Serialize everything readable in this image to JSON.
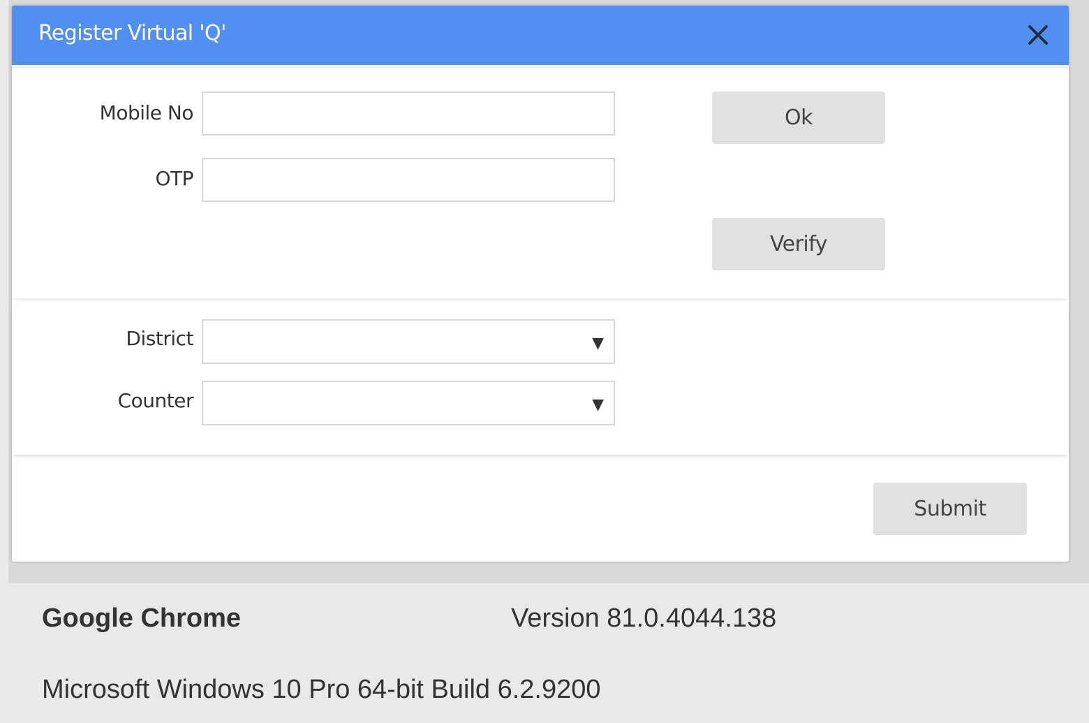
{
  "modal": {
    "title": "Register Virtual 'Q'",
    "header_color": "#5190f0"
  },
  "form": {
    "mobile_label": "Mobile No",
    "mobile_value": "",
    "otp_label": "OTP",
    "otp_value": "",
    "ok_label": "Ok",
    "verify_label": "Verify",
    "district_label": "District",
    "district_value": "",
    "counter_label": "Counter",
    "counter_value": "",
    "submit_label": "Submit"
  },
  "info": {
    "browser_name": "Google Chrome",
    "browser_version": "Version 81.0.4044.138",
    "os": "Microsoft Windows 10 Pro 64-bit Build 6.2.9200"
  },
  "icons": {
    "close": "close-icon",
    "dropdown": "triangle-down-icon"
  }
}
